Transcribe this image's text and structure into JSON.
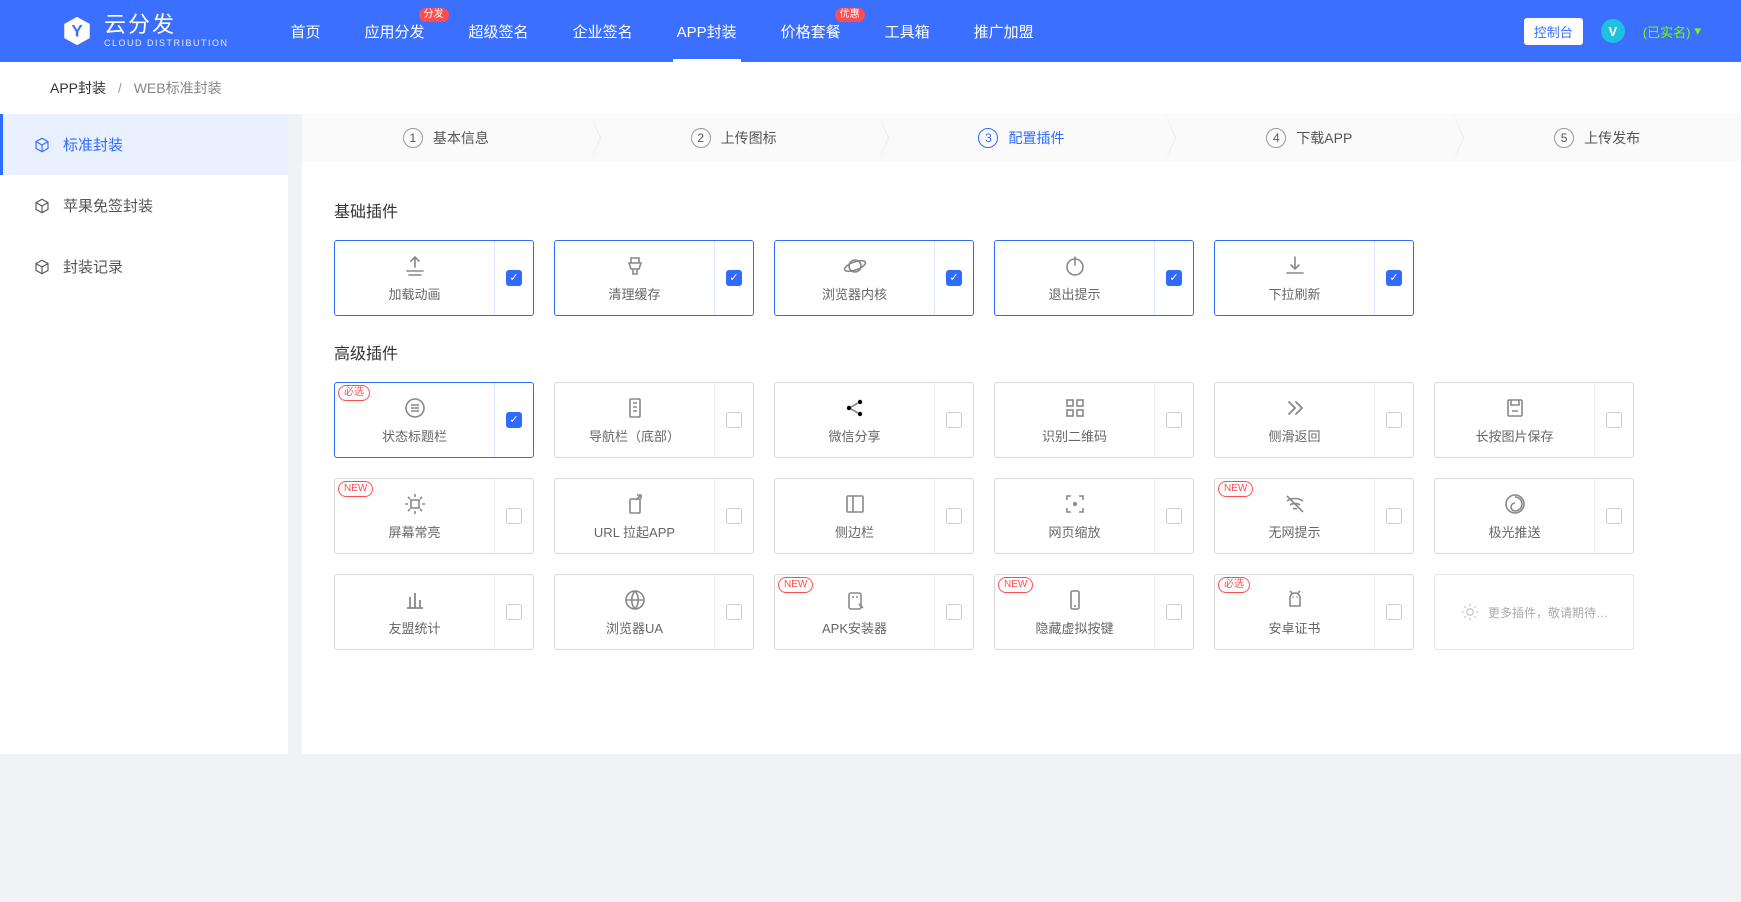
{
  "brand": {
    "cn": "云分发",
    "en": "CLOUD DISTRIBUTION",
    "avatar_letter": "V"
  },
  "nav": {
    "items": [
      {
        "label": "首页"
      },
      {
        "label": "应用分发",
        "badge": "分发"
      },
      {
        "label": "超级签名"
      },
      {
        "label": "企业签名"
      },
      {
        "label": "APP封装",
        "active": true
      },
      {
        "label": "价格套餐",
        "badge": "优惠"
      },
      {
        "label": "工具箱"
      },
      {
        "label": "推广加盟"
      }
    ],
    "console": "控制台",
    "verified": "(已实名)",
    "caret": "▾"
  },
  "breadcrumb": {
    "a": "APP封装",
    "b": "WEB标准封装",
    "sep": "/"
  },
  "sidebar": {
    "items": [
      {
        "label": "标准封装",
        "active": true
      },
      {
        "label": "苹果免签封装"
      },
      {
        "label": "封装记录"
      }
    ]
  },
  "steps": [
    {
      "num": "1",
      "label": "基本信息"
    },
    {
      "num": "2",
      "label": "上传图标"
    },
    {
      "num": "3",
      "label": "配置插件",
      "active": true
    },
    {
      "num": "4",
      "label": "下载APP"
    },
    {
      "num": "5",
      "label": "上传发布"
    }
  ],
  "sections": {
    "basic_title": "基础插件",
    "advanced_title": "高级插件",
    "basic": [
      {
        "label": "加载动画",
        "icon": "upload",
        "checked": true
      },
      {
        "label": "清理缓存",
        "icon": "brush",
        "checked": true
      },
      {
        "label": "浏览器内核",
        "icon": "planet",
        "checked": true
      },
      {
        "label": "退出提示",
        "icon": "power",
        "checked": true
      },
      {
        "label": "下拉刷新",
        "icon": "download",
        "checked": true
      }
    ],
    "advanced": [
      {
        "label": "状态标题栏",
        "icon": "menu-circle",
        "checked": true,
        "tag": "必选"
      },
      {
        "label": "导航栏（底部）",
        "icon": "doc",
        "checked": false
      },
      {
        "label": "微信分享",
        "icon": "share",
        "checked": false
      },
      {
        "label": "识别二维码",
        "icon": "qr",
        "checked": false
      },
      {
        "label": "侧滑返回",
        "icon": "chevrons",
        "checked": false
      },
      {
        "label": "长按图片保存",
        "icon": "save",
        "checked": false
      },
      {
        "label": "屏幕常亮",
        "icon": "sun",
        "checked": false,
        "tag": "NEW"
      },
      {
        "label": "URL 拉起APP",
        "icon": "link-up",
        "checked": false
      },
      {
        "label": "侧边栏",
        "icon": "sidepanel",
        "checked": false
      },
      {
        "label": "网页缩放",
        "icon": "zoom-corners",
        "checked": false
      },
      {
        "label": "无网提示",
        "icon": "wifi-off",
        "checked": false,
        "tag": "NEW"
      },
      {
        "label": "极光推送",
        "icon": "swirl",
        "checked": false
      },
      {
        "label": "友盟统计",
        "icon": "bars",
        "checked": false
      },
      {
        "label": "浏览器UA",
        "icon": "globe-grid",
        "checked": false
      },
      {
        "label": "APK安装器",
        "icon": "android-tool",
        "checked": false,
        "tag": "NEW"
      },
      {
        "label": "隐藏虚拟按键",
        "icon": "phone",
        "checked": false,
        "tag": "NEW"
      },
      {
        "label": "安卓证书",
        "icon": "android",
        "checked": false,
        "tag": "必选"
      }
    ],
    "placeholder": "更多插件，敬请期待…"
  }
}
